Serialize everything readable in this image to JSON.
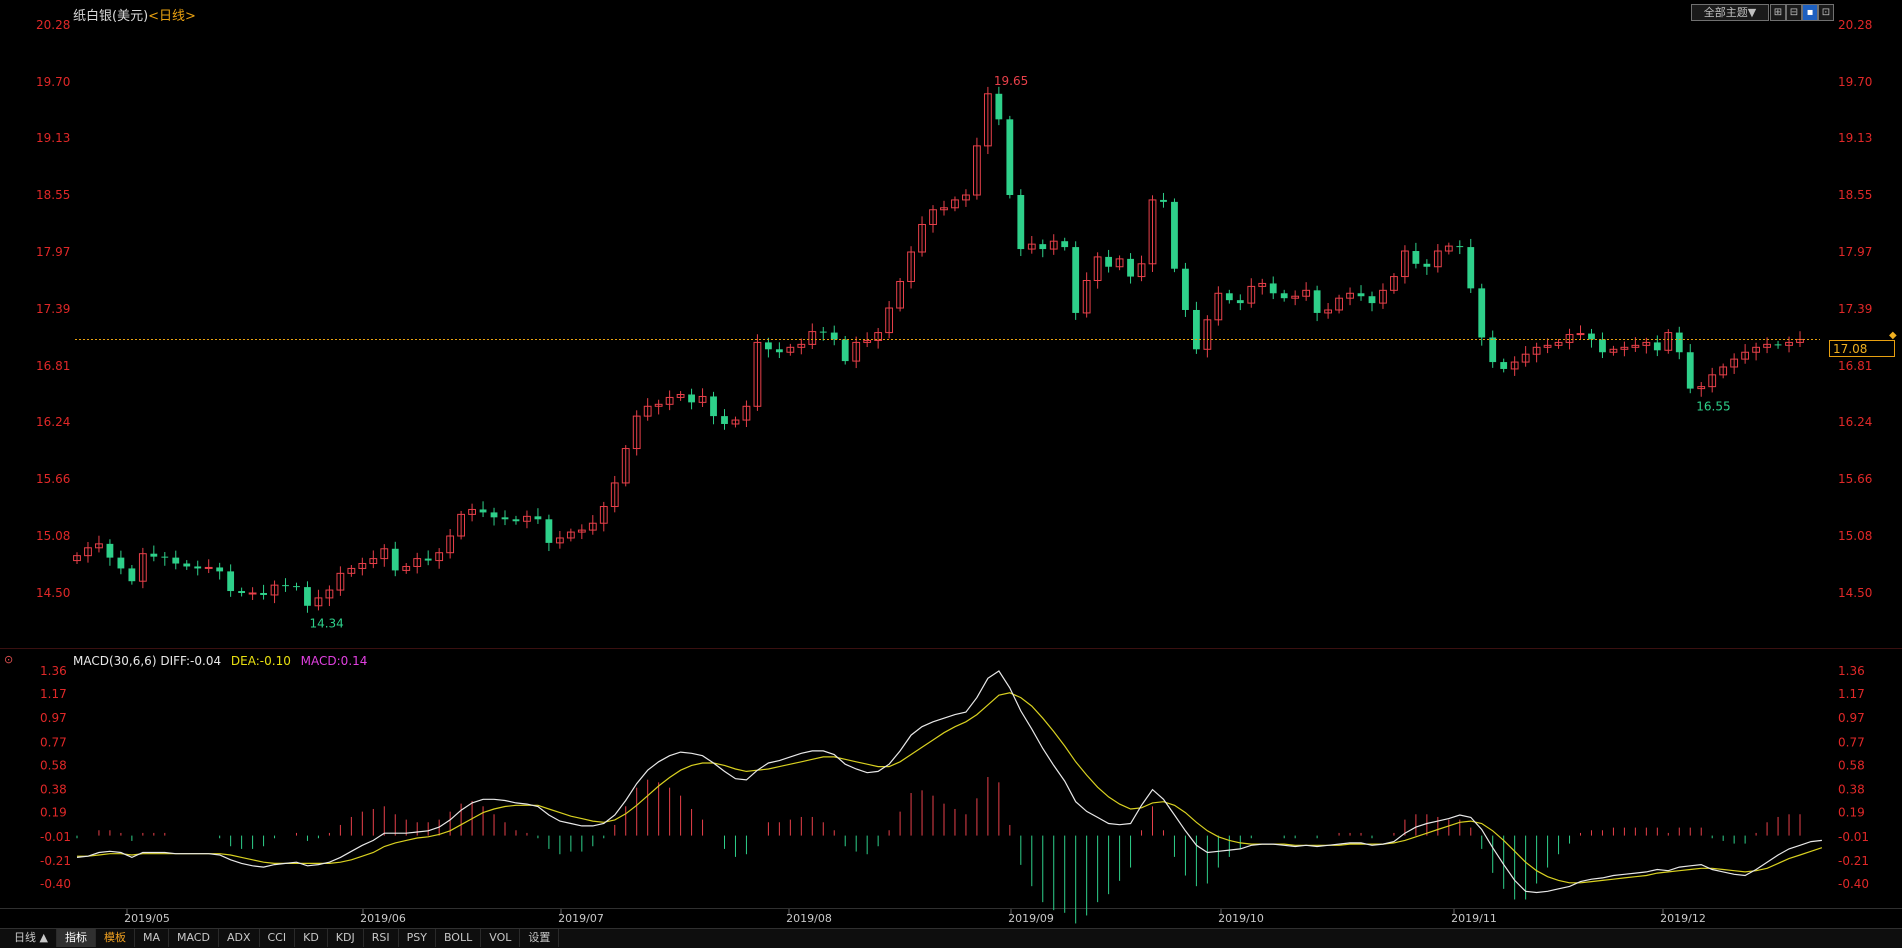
{
  "header": {
    "instrument": "纸白银(美元)",
    "period": "<日线>",
    "theme_button": "全部主题▼",
    "window_buttons": [
      "⊞",
      "⊟",
      "▪",
      "⊡"
    ]
  },
  "macd_header": {
    "label": "MACD(30,6,6)",
    "diff": "DIFF:-0.04",
    "dea": "DEA:-0.10",
    "macd": "MACD:0.14"
  },
  "current_price_tag": "17.08",
  "bottom": {
    "period_button": "日线 ▲",
    "tabs": [
      "指标",
      "模板",
      "MA",
      "MACD",
      "ADX",
      "CCI",
      "KD",
      "KDJ",
      "RSI",
      "PSY",
      "BOLL",
      "VOL",
      "设置"
    ]
  },
  "colors": {
    "up": "#e8404a",
    "down": "#2ed08a",
    "diff": "#e8e8e8",
    "dea": "#d8d020",
    "axis_label": "#e02828",
    "price_line": "#e8a010"
  },
  "chart_data": [
    {
      "type": "candlestick",
      "y_ticks": [
        "20.28",
        "19.70",
        "19.13",
        "18.55",
        "17.97",
        "17.39",
        "16.81",
        "16.24",
        "15.66",
        "15.08",
        "14.50"
      ],
      "ylim": [
        13.95,
        20.28
      ],
      "x_ticks": [
        "2019/05",
        "2019/06",
        "2019/07",
        "2019/08",
        "2019/09",
        "2019/10",
        "2019/11",
        "2019/12"
      ],
      "annotations": {
        "high_label": "19.65",
        "low_label": "14.34",
        "low2_label": "16.55"
      },
      "current_price": 17.08,
      "closes": [
        14.88,
        14.96,
        15.0,
        14.86,
        14.75,
        14.62,
        14.9,
        14.87,
        14.86,
        14.8,
        14.77,
        14.75,
        14.76,
        14.72,
        14.52,
        14.5,
        14.5,
        14.48,
        14.58,
        14.57,
        14.56,
        14.37,
        14.45,
        14.53,
        14.7,
        14.75,
        14.8,
        14.85,
        14.95,
        14.73,
        14.77,
        14.85,
        14.83,
        14.91,
        15.08,
        15.3,
        15.35,
        15.32,
        15.27,
        15.25,
        15.23,
        15.28,
        15.25,
        15.01,
        15.06,
        15.12,
        15.14,
        15.21,
        15.38,
        15.62,
        15.97,
        16.3,
        16.4,
        16.42,
        16.49,
        16.52,
        16.44,
        16.5,
        16.3,
        16.22,
        16.26,
        16.4,
        17.05,
        16.98,
        16.95,
        17.0,
        17.03,
        17.16,
        17.15,
        17.08,
        16.86,
        17.05,
        17.07,
        17.15,
        17.4,
        17.67,
        17.97,
        18.25,
        18.4,
        18.42,
        18.5,
        18.55,
        19.05,
        19.58,
        19.32,
        18.55,
        18.0,
        18.05,
        18.0,
        18.08,
        18.02,
        17.35,
        17.68,
        17.92,
        17.82,
        17.9,
        17.72,
        17.85,
        18.5,
        18.48,
        17.8,
        17.38,
        16.98,
        17.28,
        17.55,
        17.48,
        17.45,
        17.62,
        17.65,
        17.55,
        17.5,
        17.52,
        17.58,
        17.35,
        17.38,
        17.5,
        17.55,
        17.52,
        17.45,
        17.58,
        17.72,
        17.98,
        17.85,
        17.82,
        17.98,
        18.03,
        18.02,
        17.6,
        17.1,
        16.85,
        16.78,
        16.85,
        16.93,
        17.0,
        17.02,
        17.05,
        17.13,
        17.14,
        17.08,
        16.95,
        16.98,
        17.0,
        17.02,
        17.05,
        16.97,
        17.15,
        16.95,
        16.58,
        16.6,
        16.72,
        16.8,
        16.88,
        16.95,
        17.0,
        17.03,
        17.02,
        17.05,
        17.08
      ]
    },
    {
      "type": "macd",
      "title": "MACD(30,6,6)",
      "y_ticks": [
        "1.36",
        "1.17",
        "0.97",
        "0.77",
        "0.58",
        "0.38",
        "0.19",
        "-0.01",
        "-0.21",
        "-0.40"
      ],
      "ylim": [
        -0.58,
        1.36
      ],
      "series": [
        {
          "name": "DIFF",
          "values": [
            -0.18,
            -0.17,
            -0.14,
            -0.13,
            -0.14,
            -0.18,
            -0.14,
            -0.14,
            -0.14,
            -0.15,
            -0.15,
            -0.15,
            -0.15,
            -0.16,
            -0.2,
            -0.23,
            -0.25,
            -0.26,
            -0.24,
            -0.23,
            -0.22,
            -0.25,
            -0.24,
            -0.22,
            -0.18,
            -0.13,
            -0.08,
            -0.04,
            0.02,
            0.02,
            0.02,
            0.03,
            0.04,
            0.07,
            0.13,
            0.21,
            0.27,
            0.3,
            0.3,
            0.29,
            0.27,
            0.26,
            0.24,
            0.17,
            0.12,
            0.1,
            0.08,
            0.08,
            0.1,
            0.17,
            0.29,
            0.43,
            0.54,
            0.61,
            0.66,
            0.69,
            0.68,
            0.66,
            0.6,
            0.53,
            0.47,
            0.46,
            0.54,
            0.6,
            0.62,
            0.65,
            0.68,
            0.7,
            0.7,
            0.67,
            0.59,
            0.55,
            0.52,
            0.53,
            0.59,
            0.7,
            0.83,
            0.9,
            0.94,
            0.97,
            1.0,
            1.02,
            1.14,
            1.3,
            1.36,
            1.22,
            1.03,
            0.88,
            0.72,
            0.58,
            0.45,
            0.28,
            0.2,
            0.15,
            0.1,
            0.09,
            0.1,
            0.25,
            0.38,
            0.3,
            0.17,
            0.04,
            -0.08,
            -0.14,
            -0.13,
            -0.12,
            -0.11,
            -0.08,
            -0.07,
            -0.07,
            -0.08,
            -0.09,
            -0.08,
            -0.09,
            -0.08,
            -0.07,
            -0.06,
            -0.06,
            -0.08,
            -0.07,
            -0.05,
            0.02,
            0.07,
            0.1,
            0.12,
            0.14,
            0.17,
            0.15,
            0.05,
            -0.1,
            -0.24,
            -0.37,
            -0.46,
            -0.47,
            -0.46,
            -0.44,
            -0.42,
            -0.38,
            -0.36,
            -0.35,
            -0.33,
            -0.32,
            -0.31,
            -0.3,
            -0.28,
            -0.29,
            -0.26,
            -0.25,
            -0.24,
            -0.28,
            -0.3,
            -0.32,
            -0.33,
            -0.28,
            -0.22,
            -0.16,
            -0.11,
            -0.08,
            -0.05,
            -0.04
          ]
        },
        {
          "name": "DEA",
          "values": [
            -0.17,
            -0.17,
            -0.16,
            -0.15,
            -0.15,
            -0.16,
            -0.15,
            -0.15,
            -0.15,
            -0.15,
            -0.15,
            -0.15,
            -0.15,
            -0.15,
            -0.16,
            -0.18,
            -0.2,
            -0.22,
            -0.23,
            -0.23,
            -0.23,
            -0.23,
            -0.23,
            -0.23,
            -0.22,
            -0.2,
            -0.17,
            -0.14,
            -0.09,
            -0.06,
            -0.04,
            -0.02,
            -0.01,
            0.01,
            0.04,
            0.09,
            0.14,
            0.19,
            0.22,
            0.24,
            0.25,
            0.25,
            0.25,
            0.22,
            0.19,
            0.16,
            0.14,
            0.12,
            0.11,
            0.13,
            0.18,
            0.25,
            0.33,
            0.41,
            0.48,
            0.54,
            0.58,
            0.6,
            0.6,
            0.58,
            0.55,
            0.53,
            0.54,
            0.55,
            0.57,
            0.59,
            0.61,
            0.63,
            0.65,
            0.65,
            0.63,
            0.61,
            0.59,
            0.57,
            0.57,
            0.61,
            0.67,
            0.73,
            0.79,
            0.85,
            0.9,
            0.94,
            1.0,
            1.08,
            1.16,
            1.18,
            1.14,
            1.07,
            0.97,
            0.86,
            0.74,
            0.61,
            0.5,
            0.4,
            0.32,
            0.26,
            0.22,
            0.23,
            0.27,
            0.28,
            0.25,
            0.19,
            0.11,
            0.04,
            -0.01,
            -0.04,
            -0.06,
            -0.07,
            -0.07,
            -0.07,
            -0.07,
            -0.08,
            -0.08,
            -0.08,
            -0.08,
            -0.08,
            -0.07,
            -0.07,
            -0.07,
            -0.07,
            -0.06,
            -0.04,
            -0.01,
            0.02,
            0.05,
            0.08,
            0.11,
            0.12,
            0.1,
            0.04,
            -0.04,
            -0.13,
            -0.22,
            -0.29,
            -0.34,
            -0.37,
            -0.39,
            -0.39,
            -0.38,
            -0.37,
            -0.36,
            -0.35,
            -0.34,
            -0.33,
            -0.31,
            -0.3,
            -0.29,
            -0.28,
            -0.27,
            -0.27,
            -0.28,
            -0.29,
            -0.3,
            -0.29,
            -0.27,
            -0.23,
            -0.19,
            -0.16,
            -0.13,
            -0.1
          ]
        }
      ]
    }
  ]
}
